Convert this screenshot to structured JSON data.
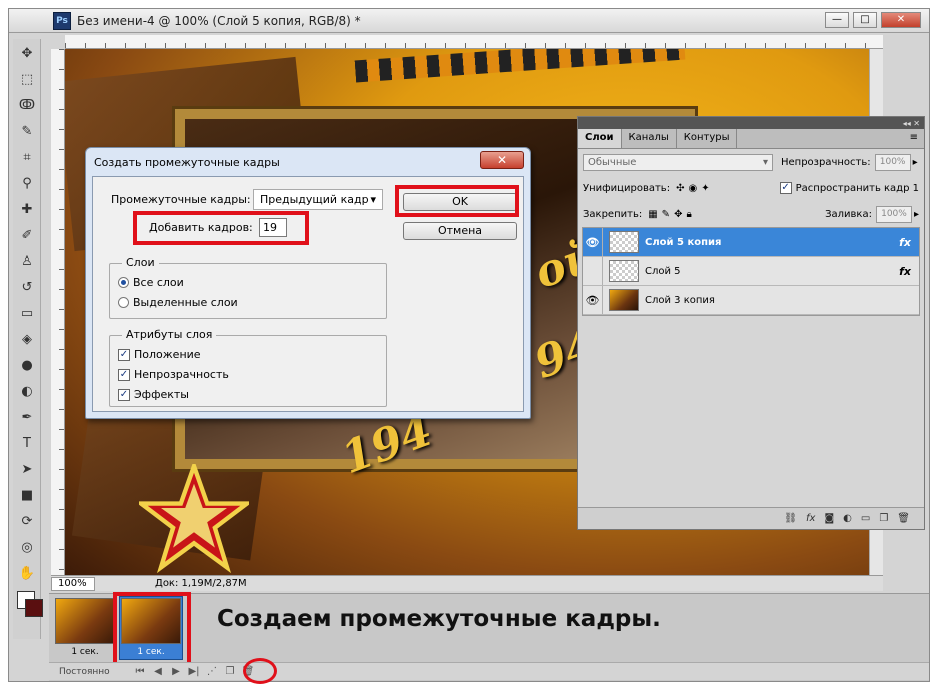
{
  "window": {
    "title": "Без имени-4 @ 100% (Слой 5 копия, RGB/8) *",
    "app_icon": "Ps",
    "controls": [
      "minimize-icon",
      "maximize-icon",
      "close-icon"
    ]
  },
  "canvas": {
    "years": [
      "ой",
      "94",
      "194"
    ]
  },
  "statusbar": {
    "zoom": "100%",
    "doc_info": "Док: 1,19M/2,87M"
  },
  "dialog": {
    "title": "Создать промежуточные кадры",
    "close_symbol": "✕",
    "tween_with_label": "Промежуточные кадры:",
    "tween_with_value": "Предыдущий кадр",
    "frames_to_add_label": "Добавить кадров:",
    "frames_to_add_value": "19",
    "ok_label": "OK",
    "cancel_label": "Отмена",
    "layers_group": {
      "title": "Слои",
      "options": [
        {
          "label": "Все слои",
          "selected": true
        },
        {
          "label": "Выделенные слои",
          "selected": false
        }
      ]
    },
    "params_group": {
      "title": "Атрибуты слоя",
      "options": [
        {
          "label": "Положение",
          "checked": true
        },
        {
          "label": "Непрозрачность",
          "checked": true
        },
        {
          "label": "Эффекты",
          "checked": true
        }
      ]
    }
  },
  "layers_panel": {
    "tabs": [
      "Слои",
      "Каналы",
      "Контуры"
    ],
    "blend_mode": "Обычные",
    "opacity_label": "Непрозрачность:",
    "opacity_value": "100%",
    "unify_label": "Унифицировать:",
    "propagate_label": "Распространить кадр 1",
    "lock_label": "Закрепить:",
    "fill_label": "Заливка:",
    "fill_value": "100%",
    "layers": [
      {
        "name": "Слой 5 копия",
        "visible": true,
        "selected": true,
        "fx": "fx",
        "thumb": "transparent"
      },
      {
        "name": "Слой 5",
        "visible": false,
        "selected": false,
        "fx": "fx",
        "thumb": "transparent"
      },
      {
        "name": "Слой 3  копия",
        "visible": true,
        "selected": false,
        "fx": "",
        "thumb": "image"
      }
    ]
  },
  "animation": {
    "frames": [
      {
        "delay": "1 сек."
      },
      {
        "delay": "1 сек.",
        "selected": true
      }
    ],
    "loop": "Постоянно",
    "caption": "Создаем промежуточные кадры."
  },
  "colors": {
    "highlight_red": "#e0101a",
    "selection_blue": "#3a86d8"
  }
}
